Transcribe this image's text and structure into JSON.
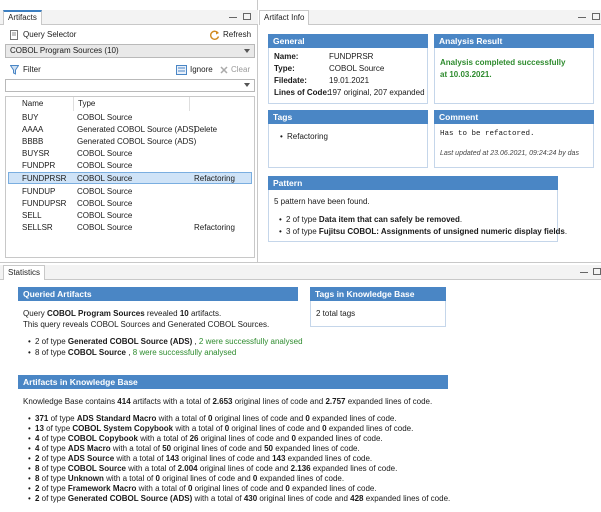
{
  "artifacts_view": {
    "tab_label": "Artifacts",
    "query_selector_label": "Query Selector",
    "refresh_label": "Refresh",
    "combo_value": "COBOL Program Sources  (10)",
    "filter_label": "Filter",
    "ignore_label": "Ignore",
    "clear_label": "Clear",
    "columns": [
      "Name",
      "Type"
    ],
    "rows": [
      {
        "name": "BUY",
        "type": "COBOL Source",
        "note": ""
      },
      {
        "name": "AAAA",
        "type": "Generated COBOL Source (ADS)",
        "note": "Delete"
      },
      {
        "name": "BBBB",
        "type": "Generated COBOL Source (ADS)",
        "note": ""
      },
      {
        "name": "BUYSR",
        "type": "COBOL Source",
        "note": ""
      },
      {
        "name": "FUNDPR",
        "type": "COBOL Source",
        "note": ""
      },
      {
        "name": "FUNDPRSR",
        "type": "COBOL Source",
        "note": "Refactoring"
      },
      {
        "name": "FUNDUP",
        "type": "COBOL Source",
        "note": ""
      },
      {
        "name": "FUNDUPSR",
        "type": "COBOL Source",
        "note": ""
      },
      {
        "name": "SELL",
        "type": "COBOL Source",
        "note": ""
      },
      {
        "name": "SELLSR",
        "type": "COBOL Source",
        "note": "Refactoring"
      }
    ]
  },
  "artifact_info": {
    "tab_label": "Artifact Info",
    "general": {
      "title": "General",
      "name_label": "Name:",
      "name": "FUNDPRSR",
      "type_label": "Type:",
      "type": "COBOL Source",
      "filedate_label": "Filedate:",
      "filedate": "19.01.2021",
      "loc_label": "Lines of Code:",
      "loc": "197 original, 207 expanded"
    },
    "analysis": {
      "title": "Analysis Result",
      "line1": "Analysis completed successfully",
      "line2": "at 10.03.2021."
    },
    "tags": {
      "title": "Tags",
      "items": [
        "Refactoring"
      ]
    },
    "comment": {
      "title": "Comment",
      "text": "Has to be refactored.",
      "updated": "Last updated at 23.06.2021, 09:24:24 by das"
    },
    "pattern": {
      "title": "Pattern",
      "summary": "5 pattern have been found.",
      "items": [
        {
          "pre": "2 of type ",
          "bold": "Data item that can safely be removed",
          "post": "."
        },
        {
          "pre": "3 of type ",
          "bold": "Fujitsu COBOL: Assignments of unsigned numeric display fields",
          "post": "."
        }
      ]
    }
  },
  "statistics": {
    "tab_label": "Statistics",
    "queried": {
      "title": "Queried Artifacts",
      "l1_pre": "Query ",
      "l1_b1": "COBOL Program Sources",
      "l1_mid": " revealed ",
      "l1_b2": "10",
      "l1_post": " artifacts.",
      "l2": "This query reveals COBOL Sources and Generated COBOL Sources.",
      "items": [
        {
          "pre": "2",
          "mid": " of type ",
          "bold": "Generated COBOL Source (ADS)",
          "sep": " , ",
          "green": "2 were successfully analysed"
        },
        {
          "pre": "8",
          "mid": " of type ",
          "bold": "COBOL Source",
          "sep": " , ",
          "green": "8 were successfully analysed"
        }
      ]
    },
    "tags_kb": {
      "title": "Tags in Knowledge Base",
      "text": "2 total tags"
    },
    "artifacts_kb": {
      "title": "Artifacts in Knowledge Base",
      "summary_pre": "Knowledge Base contains ",
      "summary_b1": "414",
      "summary_mid1": " artifacts with a total of ",
      "summary_b2": "2.653",
      "summary_mid2": " original lines of code and ",
      "summary_b3": "2.757",
      "summary_post": " expanded lines of code.",
      "items": [
        {
          "count": "371",
          "type": "ADS Standard Macro",
          "orig": "0",
          "exp": "0"
        },
        {
          "count": "13",
          "type": "COBOL System Copybook",
          "orig": "0",
          "exp": "0"
        },
        {
          "count": "4",
          "type": "COBOL Copybook",
          "orig": "26",
          "exp": "0"
        },
        {
          "count": "4",
          "type": "ADS Macro",
          "orig": "50",
          "exp": "50"
        },
        {
          "count": "2",
          "type": "ADS Source",
          "orig": "143",
          "exp": "143"
        },
        {
          "count": "8",
          "type": "COBOL Source",
          "orig": "2.004",
          "exp": "2.136"
        },
        {
          "count": "8",
          "type": "Unknown",
          "orig": "0",
          "exp": "0"
        },
        {
          "count": "2",
          "type": "Framework Macro",
          "orig": "0",
          "exp": "0"
        },
        {
          "count": "2",
          "type": "Generated COBOL Source (ADS)",
          "orig": "430",
          "exp": "428"
        }
      ]
    }
  }
}
